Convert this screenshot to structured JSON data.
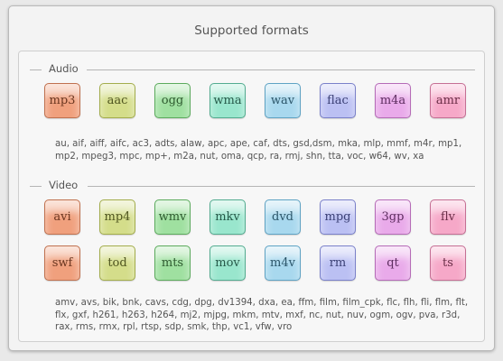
{
  "window": {
    "title": "Supported formats"
  },
  "audio": {
    "label": "Audio",
    "icons": [
      {
        "text": "mp3",
        "color": "#f0a07d",
        "border": "#c0714f",
        "fg": "#6a3620",
        "name": "mp3-format-icon"
      },
      {
        "text": "aac",
        "color": "#d4dd8a",
        "border": "#a3ad4c",
        "fg": "#4f5520",
        "name": "aac-format-icon"
      },
      {
        "text": "ogg",
        "color": "#9fe0a0",
        "border": "#5cab5d",
        "fg": "#2e5a2f",
        "name": "ogg-format-icon"
      },
      {
        "text": "wma",
        "color": "#99e6cd",
        "border": "#53ac90",
        "fg": "#275a4a",
        "name": "wma-format-icon"
      },
      {
        "text": "wav",
        "color": "#a8d8ee",
        "border": "#5fa3c4",
        "fg": "#2b5569",
        "name": "wav-format-icon"
      },
      {
        "text": "flac",
        "color": "#bbc0f3",
        "border": "#7a80c9",
        "fg": "#3b4075",
        "name": "flac-format-icon"
      },
      {
        "text": "m4a",
        "color": "#e9aaea",
        "border": "#b56bb7",
        "fg": "#5d2d5f",
        "name": "m4a-format-icon"
      },
      {
        "text": "amr",
        "color": "#f6a8c8",
        "border": "#c56f94",
        "fg": "#6a2e47",
        "name": "amr-format-icon"
      }
    ],
    "extensions": "au, aif, aiff, aifc, ac3, adts, alaw, apc, ape, caf, dts, gsd,dsm, mka, mlp, mmf, m4r, mp1, mp2, mpeg3, mpc, mp+, m2a, nut, oma, qcp, ra, rmj, shn, tta, voc, w64, wv, xa"
  },
  "video": {
    "label": "Video",
    "icons": [
      {
        "text": "avi",
        "color": "#f0a07d",
        "border": "#c0714f",
        "fg": "#6a3620",
        "name": "avi-format-icon"
      },
      {
        "text": "mp4",
        "color": "#d4dd8a",
        "border": "#a3ad4c",
        "fg": "#4f5520",
        "name": "mp4-format-icon"
      },
      {
        "text": "wmv",
        "color": "#9fe0a0",
        "border": "#5cab5d",
        "fg": "#2e5a2f",
        "name": "wmv-format-icon"
      },
      {
        "text": "mkv",
        "color": "#99e6cd",
        "border": "#53ac90",
        "fg": "#275a4a",
        "name": "mkv-format-icon"
      },
      {
        "text": "dvd",
        "color": "#a8d8ee",
        "border": "#5fa3c4",
        "fg": "#2b5569",
        "name": "dvd-format-icon"
      },
      {
        "text": "mpg",
        "color": "#bbc0f3",
        "border": "#7a80c9",
        "fg": "#3b4075",
        "name": "mpg-format-icon"
      },
      {
        "text": "3gp",
        "color": "#e9aaea",
        "border": "#b56bb7",
        "fg": "#5d2d5f",
        "name": "3gp-format-icon"
      },
      {
        "text": "flv",
        "color": "#f6a8c8",
        "border": "#c56f94",
        "fg": "#6a2e47",
        "name": "flv-format-icon"
      },
      {
        "text": "swf",
        "color": "#f0a07d",
        "border": "#c0714f",
        "fg": "#6a3620",
        "name": "swf-format-icon"
      },
      {
        "text": "tod",
        "color": "#d4dd8a",
        "border": "#a3ad4c",
        "fg": "#4f5520",
        "name": "tod-format-icon"
      },
      {
        "text": "mts",
        "color": "#9fe0a0",
        "border": "#5cab5d",
        "fg": "#2e5a2f",
        "name": "mts-format-icon"
      },
      {
        "text": "mov",
        "color": "#99e6cd",
        "border": "#53ac90",
        "fg": "#275a4a",
        "name": "mov-format-icon"
      },
      {
        "text": "m4v",
        "color": "#a8d8ee",
        "border": "#5fa3c4",
        "fg": "#2b5569",
        "name": "m4v-format-icon"
      },
      {
        "text": "rm",
        "color": "#bbc0f3",
        "border": "#7a80c9",
        "fg": "#3b4075",
        "name": "rm-format-icon"
      },
      {
        "text": "qt",
        "color": "#e9aaea",
        "border": "#b56bb7",
        "fg": "#5d2d5f",
        "name": "qt-format-icon"
      },
      {
        "text": "ts",
        "color": "#f6a8c8",
        "border": "#c56f94",
        "fg": "#6a2e47",
        "name": "ts-format-icon"
      }
    ],
    "extensions": "amv, avs, bik, bnk, cavs, cdg, dpg, dv1394, dxa, ea, ffm, film, film_cpk, flc, flh, fli, flm, flt, flx, gxf, h261, h263, h264, mj2, mjpg, mkm, mtv, mxf, nc, nut, nuv, ogm, ogv, pva, r3d, rax, rms, rmx, rpl, rtsp, sdp, smk, thp, vc1, vfw, vro"
  }
}
